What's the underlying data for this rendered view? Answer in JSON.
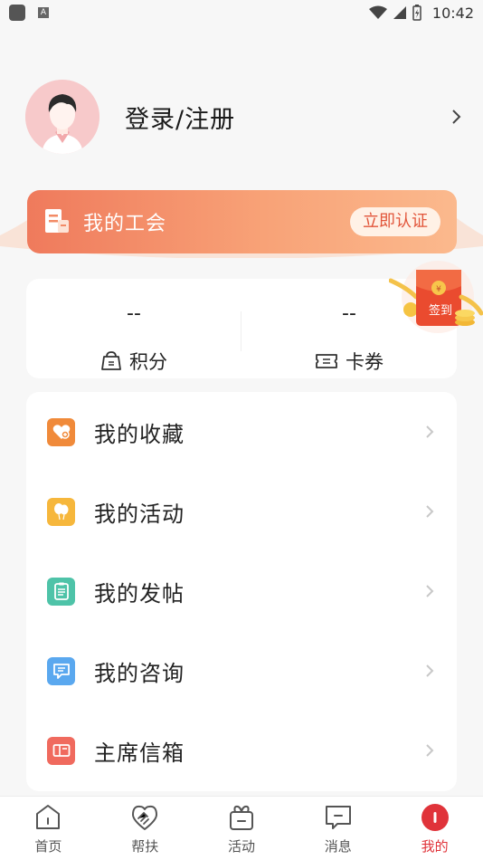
{
  "status_bar": {
    "time": "10:42",
    "a_glyph": "A"
  },
  "profile": {
    "login_label": "登录/注册"
  },
  "union": {
    "title": "我的工会",
    "action": "立即认证"
  },
  "points": {
    "points_value": "--",
    "points_label": "积分",
    "coupons_value": "--",
    "coupons_label": "卡券"
  },
  "signin": {
    "label": "签到"
  },
  "menu": {
    "items": [
      {
        "label": "我的收藏",
        "icon": "heart-plus-icon",
        "color": "#f08a3a"
      },
      {
        "label": "我的活动",
        "icon": "balloons-icon",
        "color": "#f6b73c"
      },
      {
        "label": "我的发帖",
        "icon": "clipboard-icon",
        "color": "#4ec3a8"
      },
      {
        "label": "我的咨询",
        "icon": "chat-icon",
        "color": "#5aa8ef"
      },
      {
        "label": "主席信箱",
        "icon": "mailbox-icon",
        "color": "#f06a5e"
      }
    ]
  },
  "bottom_nav": {
    "items": [
      {
        "label": "首页",
        "icon": "home-icon"
      },
      {
        "label": "帮扶",
        "icon": "handshake-icon"
      },
      {
        "label": "活动",
        "icon": "gift-icon"
      },
      {
        "label": "消息",
        "icon": "message-icon"
      },
      {
        "label": "我的",
        "icon": "profile-icon"
      }
    ],
    "active_color": "#e0333a"
  }
}
